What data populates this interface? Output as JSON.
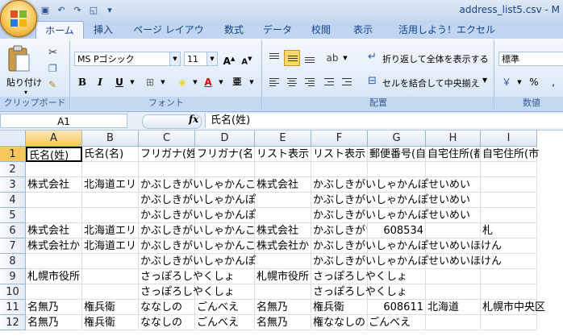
{
  "window": {
    "title": "address_list5.csv - M"
  },
  "tabs": [
    "ホーム",
    "挿入",
    "ページ レイアウト",
    "数式",
    "データ",
    "校閲",
    "表示",
    "活用しよう！エクセル"
  ],
  "ribbon": {
    "clipboard": {
      "label": "クリップボード",
      "paste": "貼り付け"
    },
    "font": {
      "label": "フォント",
      "name": "MS Pゴシック",
      "size": "11"
    },
    "alignment": {
      "label": "配置",
      "wrap": "折り返して全体を表示する",
      "merge": "セルを結合して中央揃え"
    },
    "number": {
      "label": "数値",
      "format": "標準",
      "percent": "%"
    }
  },
  "formula_bar": {
    "name_box": "A1",
    "fx": "fx",
    "content": "氏名(姓)"
  },
  "columns": [
    "A",
    "B",
    "C",
    "D",
    "E",
    "F",
    "G",
    "H",
    "I"
  ],
  "rows": [
    [
      "氏名(姓)",
      "氏名(名)",
      "フリガナ(姓)",
      "フリガナ(名)",
      "リスト表示",
      "リスト表示",
      "郵便番号(自",
      "自宅住所(都",
      "自宅住所(市"
    ],
    [
      "",
      "",
      "",
      "",
      "",
      "",
      "",
      "",
      ""
    ],
    [
      "株式会社 ",
      "北海道エリ",
      "かぶしきがいしゃかんこ",
      "",
      "株式会社 ",
      "かぶしきがいしゃかんぽせいめい",
      "",
      "",
      ""
    ],
    [
      "",
      "",
      "かぶしきがいしゃかんぽ",
      "",
      "",
      "かぶしきがいしゃかんぽせいめい",
      "",
      "",
      ""
    ],
    [
      "",
      "",
      "かぶしきがいしゃかんぽ",
      "",
      "",
      "かぶしきがいしゃかんぽせいめい",
      "",
      "",
      ""
    ],
    [
      "株式会社 ",
      "北海道エリ",
      "かぶしきがいしゃかんこ",
      "",
      "株式会社 ",
      "かぶしきがい",
      "608534",
      "",
      "札"
    ],
    [
      "株式会社か",
      "北海道エリ",
      "かぶしきがいしゃかんこ",
      "",
      "株式会社か",
      "かぶしきがいしゃかんぽせいめいほけん",
      "",
      "",
      ""
    ],
    [
      "",
      "",
      "かぶしきがいしゃかんぽ",
      "",
      "",
      "かぶしきがいしゃかんぽせいめいほけん",
      "",
      "",
      ""
    ],
    [
      "札幌市役所",
      "",
      "さっぽろしやくしょ",
      "",
      "札幌市役所",
      "さっぽろしやくしょ",
      "",
      "",
      ""
    ],
    [
      "",
      "",
      "さっぽろしやくしょ",
      "",
      "",
      "さっぽろしやくしょ",
      "",
      "",
      ""
    ],
    [
      "名無乃",
      "権兵衛",
      "ななしの",
      "ごんべえ",
      "名無乃",
      "権兵衛",
      "608611",
      "北海道",
      "札幌市中央区"
    ],
    [
      "名無乃",
      "権兵衛",
      "ななしの",
      "ごんべえ",
      "名無乃",
      "権ななしの ごんべえ",
      "",
      "",
      ""
    ]
  ],
  "row_numbers": [
    "1",
    "2",
    "3",
    "4",
    "5",
    "6",
    "7",
    "8",
    "9",
    "10",
    "11",
    "12"
  ],
  "colors": {
    "accent": "#15428b",
    "selection": "#f7c65f",
    "ribbon": "#dbe8f7"
  }
}
